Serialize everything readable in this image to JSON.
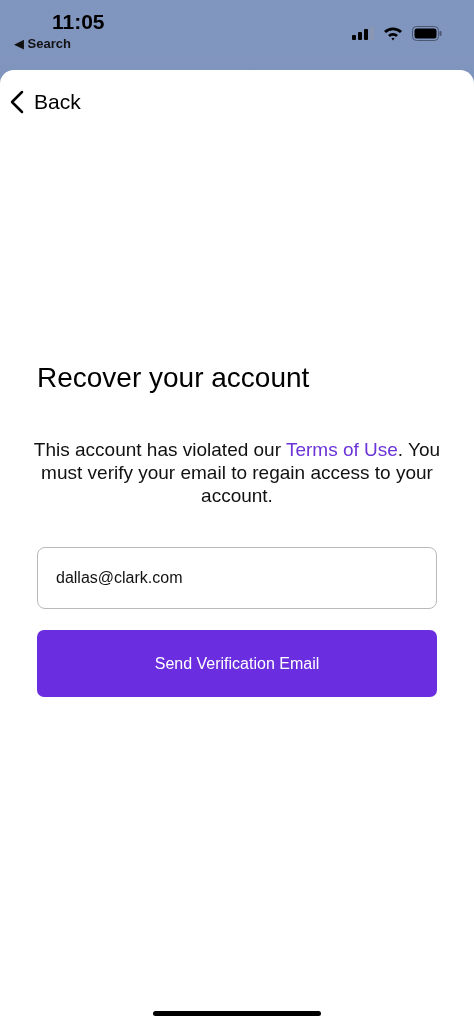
{
  "status_bar": {
    "time": "11:05",
    "back_label": "◀ Search"
  },
  "nav": {
    "back": "Back"
  },
  "title": "Recover your account",
  "message": {
    "before": "This account has violated our ",
    "link": "Terms of Use",
    "after": ". You must verify your email to regain access to your account."
  },
  "email_field": {
    "value": "dallas@clark.com"
  },
  "button": "Send Verification Email"
}
